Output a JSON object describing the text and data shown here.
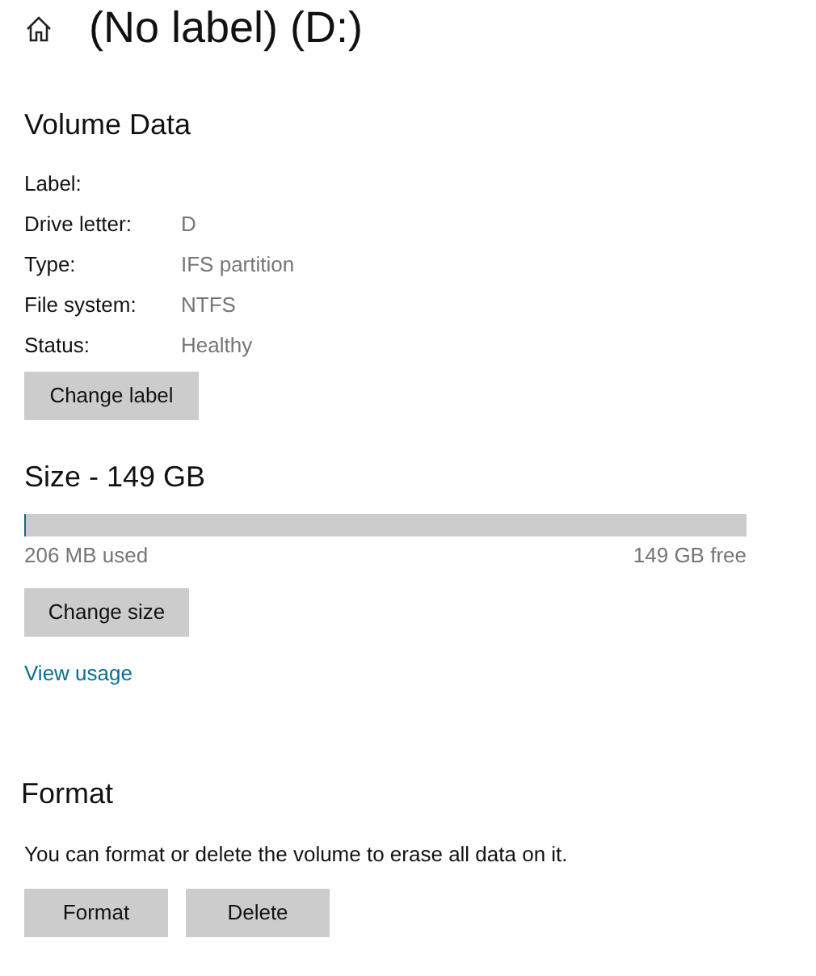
{
  "header": {
    "title": "(No label) (D:)"
  },
  "volume_data": {
    "heading": "Volume Data",
    "rows": [
      {
        "label": "Label:"
      },
      {
        "label": "Drive letter:",
        "value": "D"
      },
      {
        "label": "Type:",
        "value": "IFS partition"
      },
      {
        "label": "File system:",
        "value": "NTFS"
      },
      {
        "label": "Status:",
        "value": "Healthy"
      }
    ],
    "button": "Change label"
  },
  "size": {
    "heading": "Size - 149 GB",
    "level": 0.003,
    "used": "206 MB used",
    "free": "149 GB free",
    "button": "Change size",
    "link": "View usage"
  },
  "format": {
    "heading": "Format",
    "description": "You can format or delete the volume to erase all data on it.",
    "buttons": [
      "Format",
      "Delete"
    ]
  }
}
